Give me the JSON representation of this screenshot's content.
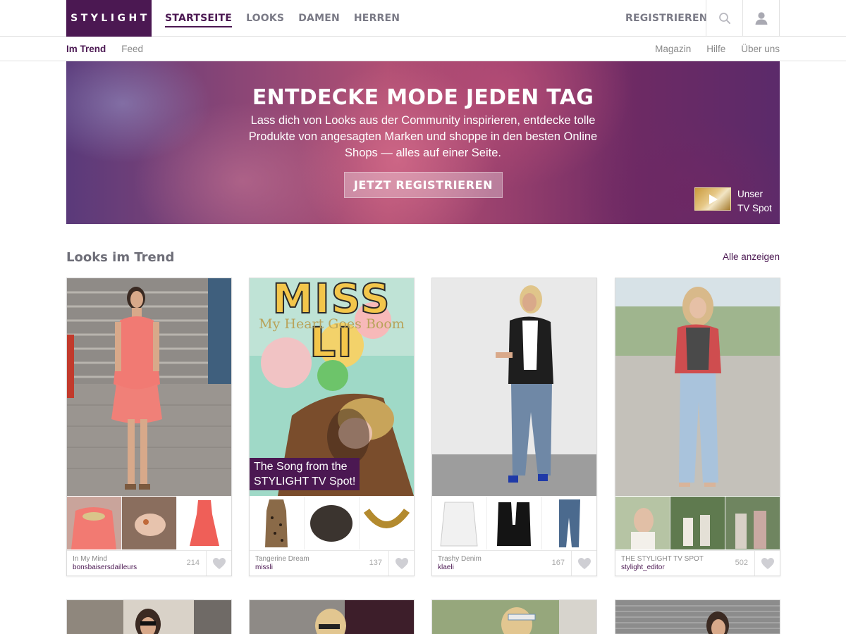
{
  "brand": {
    "logo": "STYLIGHT",
    "accent": "#4b1852"
  },
  "nav": {
    "items": [
      {
        "label": "STARTSEITE",
        "active": true
      },
      {
        "label": "LOOKS",
        "active": false
      },
      {
        "label": "DAMEN",
        "active": false
      },
      {
        "label": "HERREN",
        "active": false
      }
    ],
    "register": "REGISTRIEREN",
    "search_icon": "search-icon",
    "user_icon": "user-icon"
  },
  "subnav": {
    "left": [
      {
        "label": "Im Trend",
        "active": true
      },
      {
        "label": "Feed",
        "active": false
      }
    ],
    "right": [
      "Magazin",
      "Hilfe",
      "Über uns"
    ]
  },
  "hero": {
    "title": "ENTDECKE MODE JEDEN TAG",
    "text": "Lass dich von Looks aus der Community inspirieren, entdecke tolle Produkte von angesagten Marken und shoppe in den besten Online Shops — alles auf einer Seite.",
    "cta": "JETZT REGISTRIEREN",
    "tv_line1": "Unser",
    "tv_line2": "TV Spot"
  },
  "section": {
    "title": "Looks im Trend",
    "show_all": "Alle anzeigen"
  },
  "looks": [
    {
      "name": "In My Mind",
      "user": "bonsbaisersdailleurs",
      "likes": "214"
    },
    {
      "name": "Tangerine Dream",
      "user": "missli",
      "likes": "137",
      "headline": "MISS LI",
      "subline": "My Heart Goes Boom",
      "badge_line1": "The Song from the",
      "badge_line2": "STYLIGHT TV Spot!"
    },
    {
      "name": "Trashy Denim",
      "user": "klaeli",
      "likes": "167"
    },
    {
      "name": "THE STYLIGHT TV SPOT",
      "user": "stylight_editor",
      "likes": "502"
    }
  ]
}
